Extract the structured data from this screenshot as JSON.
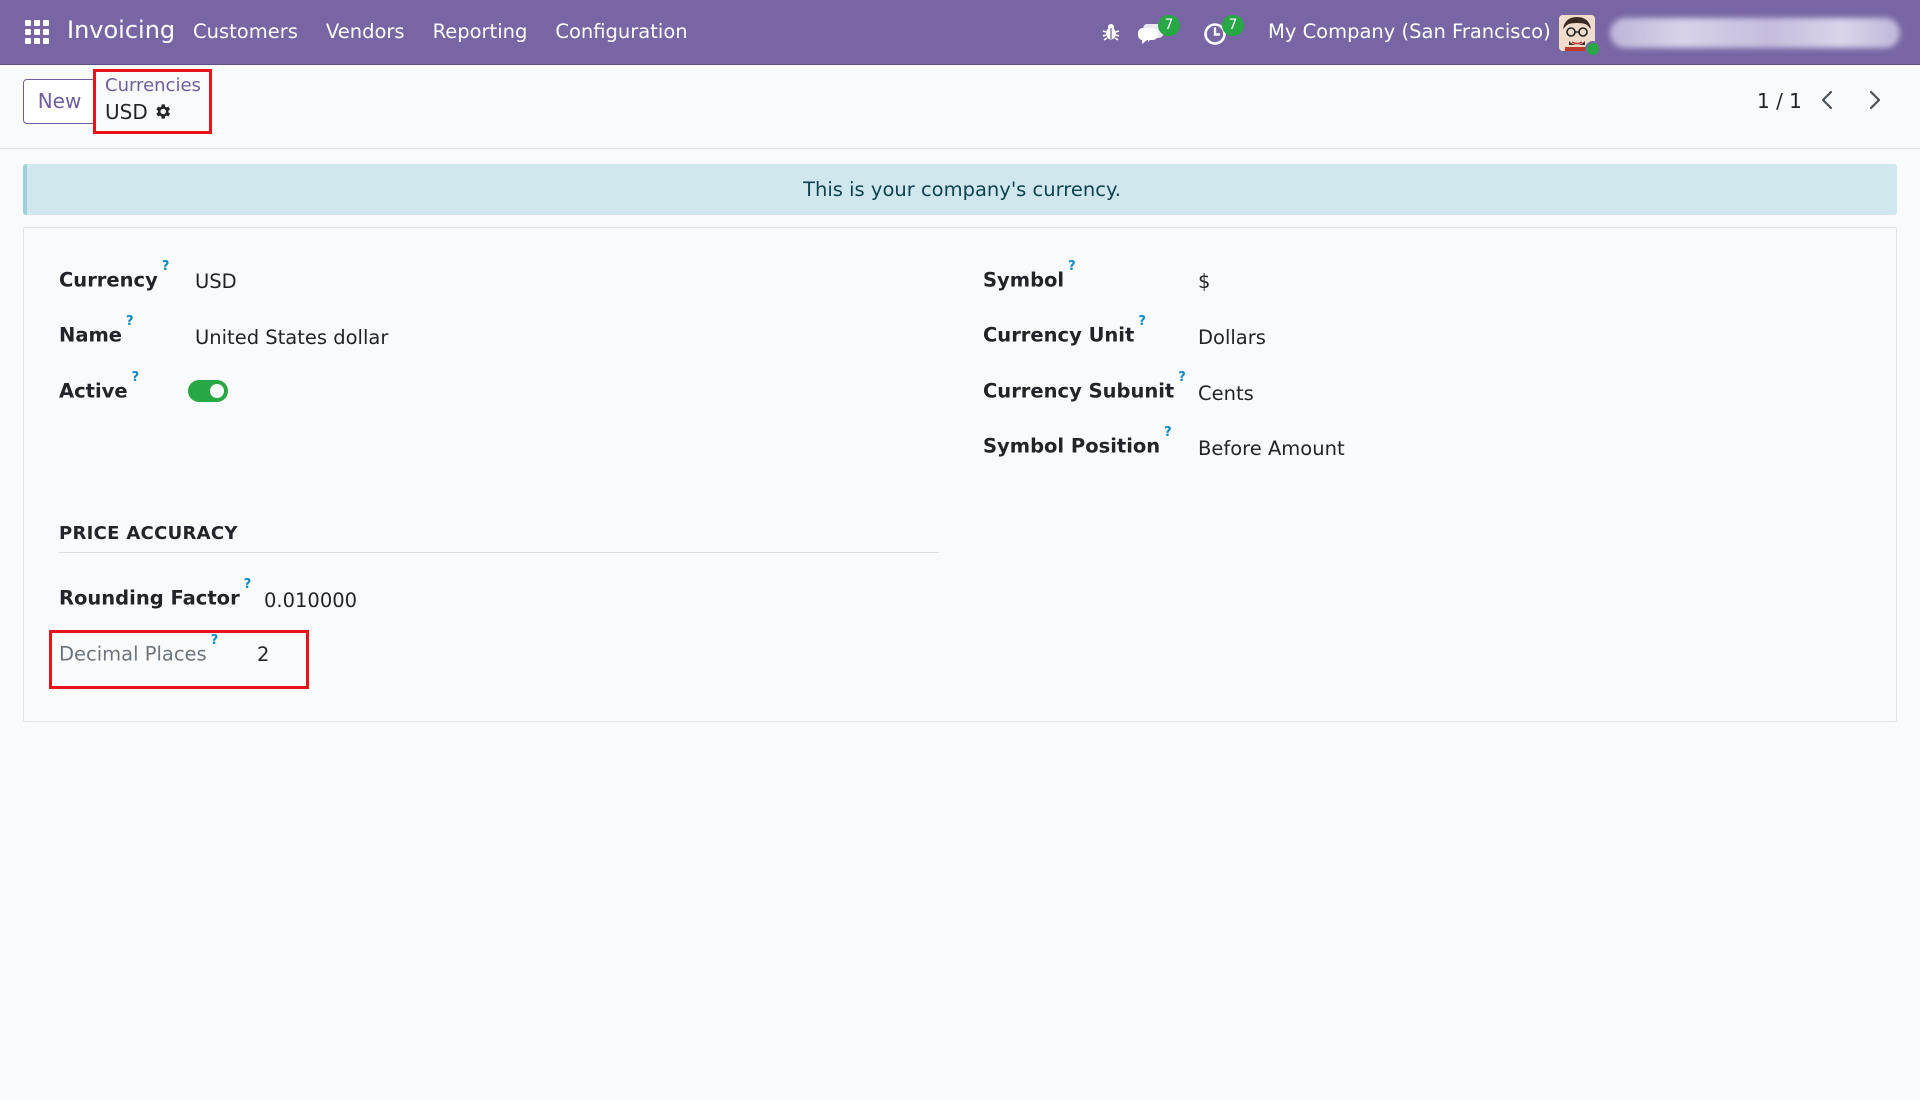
{
  "navbar": {
    "app_name": "Invoicing",
    "menu": [
      "Customers",
      "Vendors",
      "Reporting",
      "Configuration"
    ],
    "messages_badge": "7",
    "activities_badge": "7",
    "company": "My Company (San Francisco)",
    "icons": [
      "apps-grid-icon",
      "bug-icon",
      "chat-icon",
      "clock-icon",
      "avatar"
    ]
  },
  "control_panel": {
    "new_label": "New",
    "breadcrumb_parent": "Currencies",
    "breadcrumb_current": "USD",
    "pager": "1 / 1"
  },
  "alert": {
    "text": "This is your company's currency."
  },
  "form": {
    "currency_label": "Currency",
    "currency_value": "USD",
    "name_label": "Name",
    "name_value": "United States dollar",
    "active_label": "Active",
    "active_value": true,
    "symbol_label": "Symbol",
    "symbol_value": "$",
    "unit_label": "Currency Unit",
    "unit_value": "Dollars",
    "subunit_label": "Currency Subunit",
    "subunit_value": "Cents",
    "position_label": "Symbol Position",
    "position_value": "Before Amount",
    "section_title": "PRICE ACCURACY",
    "rounding_label": "Rounding Factor",
    "rounding_value": "0.010000",
    "decimal_label": "Decimal Places",
    "decimal_value": "2",
    "help_mark": "?"
  },
  "colors": {
    "navbar": "#7866a4",
    "accent": "#6f5d9c",
    "toggle_on": "#28a745",
    "alert_bg": "#d0e7ed",
    "highlight": "#e8121d"
  }
}
